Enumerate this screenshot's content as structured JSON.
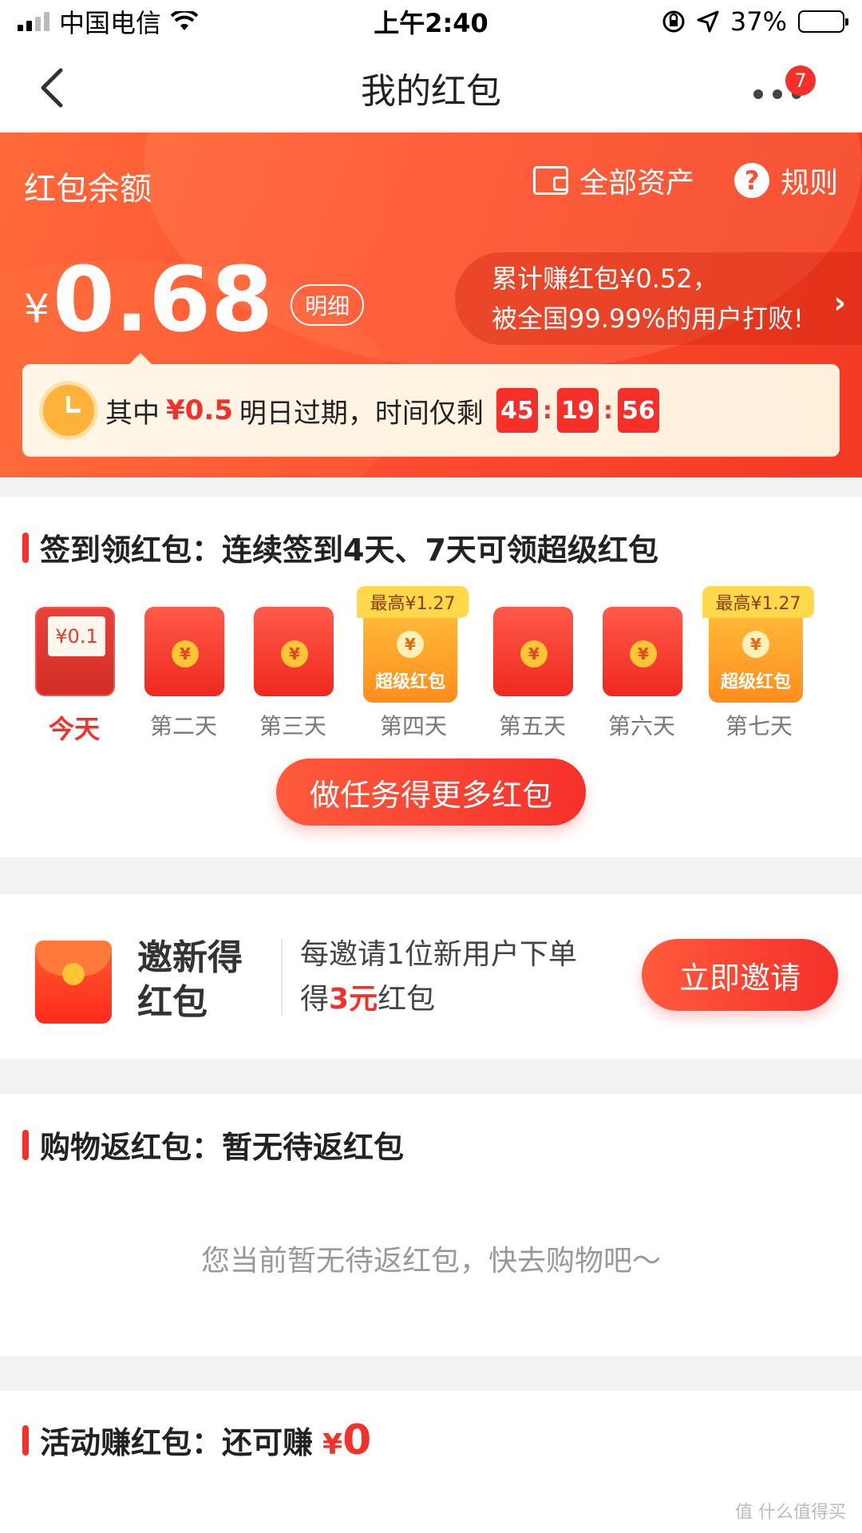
{
  "status_bar": {
    "carrier": "中国电信",
    "time": "上午2:40",
    "battery": "37%",
    "battery_level": 0.37
  },
  "nav": {
    "title": "我的红包",
    "badge_count": "7"
  },
  "hero": {
    "label": "红包余额",
    "all_assets": "全部资产",
    "rules": "规则",
    "currency": "¥",
    "balance": "0.68",
    "detail_btn": "明细",
    "earned_line1": "累计赚红包¥0.52，",
    "earned_line2": "被全国99.99%的用户打败!",
    "expire_prefix": "其中",
    "expire_amount": "¥0.5",
    "expire_suffix": "明日过期，时间仅剩",
    "timer": [
      "45",
      "19",
      "56"
    ]
  },
  "checkin": {
    "title": "签到领红包：连续签到4天、7天可领超级红包",
    "days": [
      {
        "label": "今天",
        "reward": "¥0.1",
        "type": "today"
      },
      {
        "label": "第二天",
        "type": "normal"
      },
      {
        "label": "第三天",
        "type": "normal"
      },
      {
        "label": "第四天",
        "type": "super",
        "tag": "最高¥1.27",
        "super_label": "超级红包"
      },
      {
        "label": "第五天",
        "type": "normal"
      },
      {
        "label": "第六天",
        "type": "normal"
      },
      {
        "label": "第七天",
        "type": "super",
        "tag": "最高¥1.27",
        "super_label": "超级红包"
      }
    ],
    "task_button": "做任务得更多红包"
  },
  "invite": {
    "title": "邀新得红包",
    "desc_line1": "每邀请1位新用户下单",
    "desc_pre": "得",
    "desc_amount": "3元",
    "desc_post": "红包",
    "button": "立即邀请"
  },
  "shopping": {
    "title": "购物返红包：暂无待返红包",
    "empty": "您当前暂无待返红包，快去购物吧～"
  },
  "activity": {
    "title": "活动赚红包：还可赚",
    "currency": "¥",
    "amount": "0"
  },
  "watermark": "值 什么值得买",
  "colors": {
    "accent": "#f5302a",
    "hero_start": "#ff6a3a",
    "coin": "#ffc535"
  }
}
